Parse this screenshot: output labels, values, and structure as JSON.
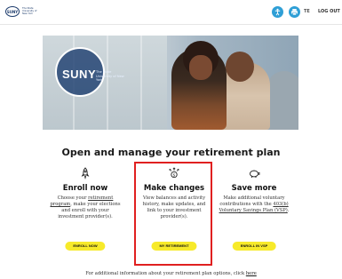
{
  "header": {
    "logo_text": "SUNY",
    "logo_subtitle": "The State University of New York",
    "user_initials": "TE",
    "logout_label": "LOG OUT",
    "accent_color": "#2f9fd6",
    "icons": [
      "accessibility-icon",
      "printer-icon"
    ]
  },
  "hero": {
    "brand": "SUNY",
    "brand_subtitle": "The State University of New York"
  },
  "page_title": "Open and manage your retirement plan",
  "cards": [
    {
      "icon": "rocket-icon",
      "title": "Enroll now",
      "desc_parts": [
        "Choose your ",
        "retirement program",
        ", make your elections and enroll with your investment provider(s)."
      ],
      "button": "ENROLL NOW"
    },
    {
      "icon": "money-arrows-icon",
      "title": "Make changes",
      "desc": "View balances and activity history, make updates, and link to your investment provider(s).",
      "button": "MY RETIREMENT"
    },
    {
      "icon": "piggy-bank-icon",
      "title": "Save more",
      "desc_parts": [
        "Make additional voluntary contributions with the ",
        "403(b) Voluntary Savings Plan (VSP)",
        "."
      ],
      "button": "ENROLL IN VSP"
    }
  ],
  "footer": {
    "text": "For additional information about your retirement plan options, click ",
    "link": "here"
  },
  "colors": {
    "button": "#f7ea2a",
    "highlight": "#e02020",
    "brand_navy": "#1b3a6b"
  }
}
